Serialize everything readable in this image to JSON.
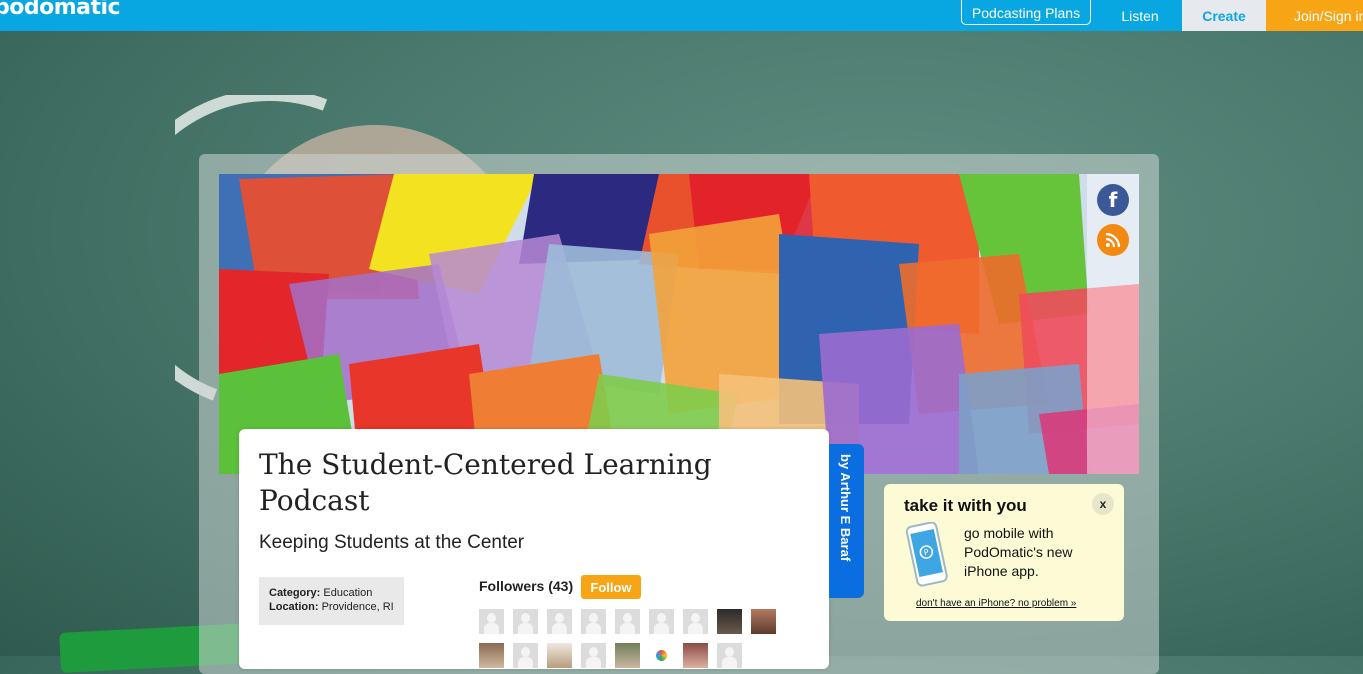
{
  "header": {
    "logo": "podomatic",
    "nav": {
      "plans": "Podcasting Plans",
      "listen": "Listen",
      "create": "Create",
      "join": "Join/Sign in"
    }
  },
  "podcast": {
    "title": "The Student-Centered Learning Podcast",
    "subtitle": "Keeping Students at the Center",
    "category_label": "Category:",
    "category": "Education",
    "location_label": "Location:",
    "location": "Providence, RI",
    "followers_label": "Followers (43)",
    "follow_button": "Follow",
    "author": "by Arthur E Baraf"
  },
  "social": {
    "facebook_icon": "f",
    "rss_icon": "rss-icon"
  },
  "promo": {
    "title": "take it with you",
    "close": "x",
    "text": "go mobile with PodOmatic's new iPhone app.",
    "link": "don't have an iPhone? no problem »"
  },
  "colors": {
    "topbar": "#08a7e2",
    "accent_orange": "#f7a515",
    "author_tab": "#0b6ee0"
  }
}
